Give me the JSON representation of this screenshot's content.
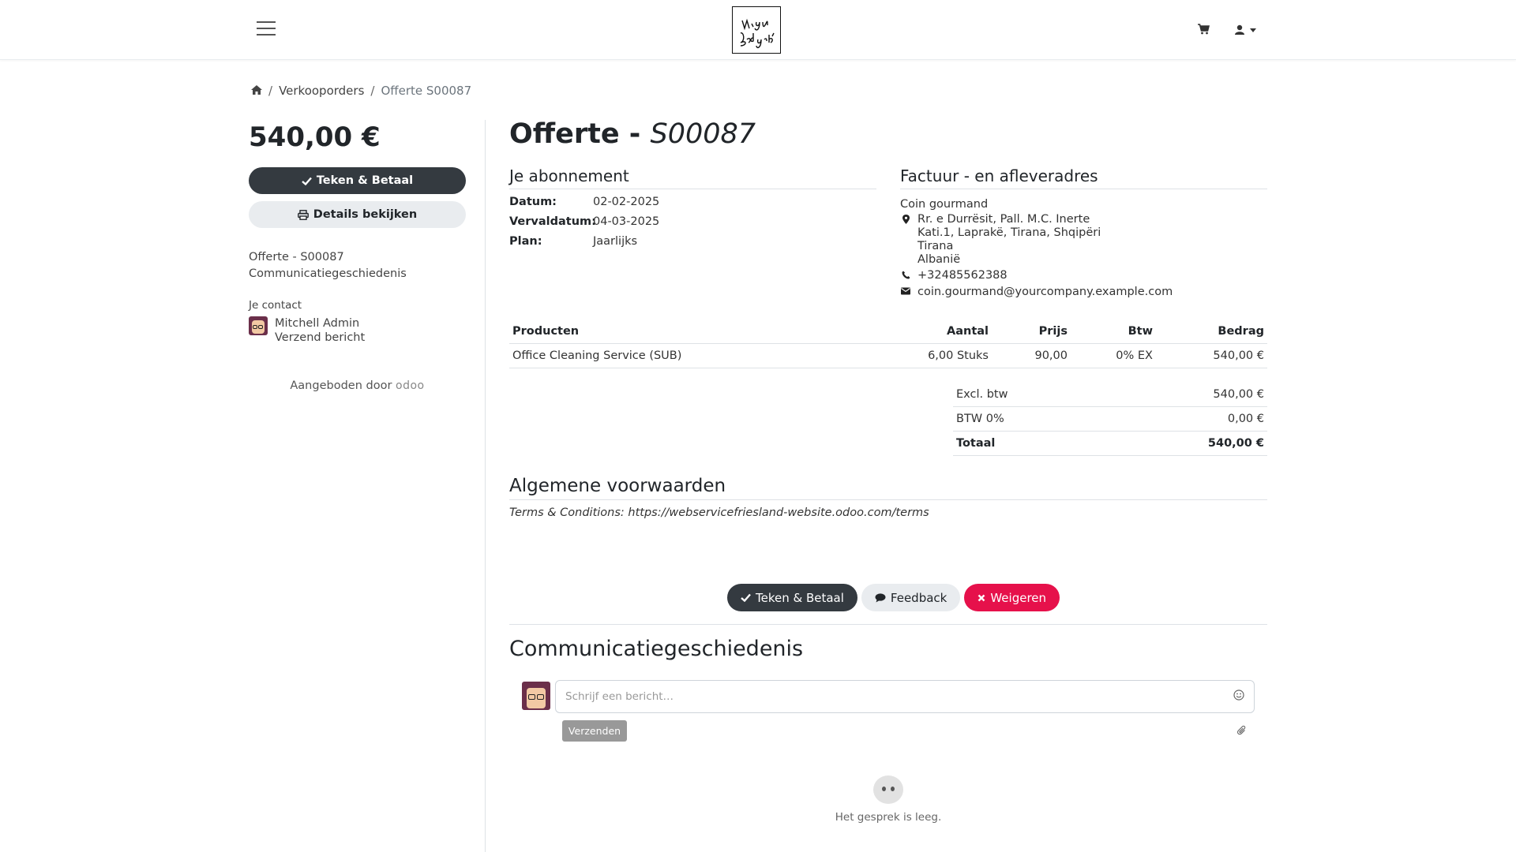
{
  "header": {
    "logo_text": "Mijn Bedrijf",
    "icons": [
      "menu-icon",
      "cart-icon",
      "user-icon"
    ]
  },
  "breadcrumb": {
    "items": [
      "Verkooporders",
      "Offerte S00087"
    ]
  },
  "sidebar": {
    "amount": "540,00 €",
    "sign_pay_label": "Teken & Betaal",
    "details_label": "Details bekijken",
    "links": [
      "Offerte - S00087",
      "Communicatiegeschiedenis"
    ],
    "contact_label": "Je contact",
    "contact_name": "Mitchell Admin",
    "contact_action": "Verzend bericht",
    "powered_by": "Aangeboden door",
    "powered_brand": "odoo"
  },
  "main": {
    "title_prefix": "Offerte - ",
    "title_ref": "S00087",
    "subscription": {
      "heading": "Je abonnement",
      "fields": [
        {
          "label": "Datum:",
          "value": "02-02-2025"
        },
        {
          "label": "Vervaldatum:",
          "value": "04-03-2025"
        },
        {
          "label": "Plan:",
          "value": "Jaarlijks"
        }
      ]
    },
    "address": {
      "heading": "Factuur - en afleveradres",
      "name": "Coin gourmand",
      "lines": [
        "Rr. e Durrësit, Pall. M.C. Inerte",
        "Kati.1, Laprakë, Tirana, Shqipëri",
        "Tirana",
        "Albanië"
      ],
      "phone": "+32485562388",
      "email": "coin.gourmand@yourcompany.example.com"
    },
    "table": {
      "headers": {
        "product": "Producten",
        "qty": "Aantal",
        "price": "Prijs",
        "tax": "Btw",
        "amount": "Bedrag"
      },
      "rows": [
        {
          "product": "Office Cleaning Service (SUB)",
          "qty": "6,00 Stuks",
          "price": "90,00",
          "tax": "0% EX",
          "amount": "540,00 €"
        }
      ]
    },
    "totals": [
      {
        "label": "Excl. btw",
        "value": "540,00 €"
      },
      {
        "label": "BTW 0%",
        "value": "0,00 €"
      },
      {
        "label": "Totaal",
        "value": "540,00 €"
      }
    ],
    "terms": {
      "heading": "Algemene voorwaarden",
      "text": "Terms & Conditions: https://webservicefriesland-website.odoo.com/terms"
    },
    "actions": {
      "sign_pay": "Teken & Betaal",
      "feedback": "Feedback",
      "decline": "Weigeren"
    },
    "chatter": {
      "heading": "Communicatiegeschiedenis",
      "placeholder": "Schrijf een bericht…",
      "send_label": "Verzenden",
      "empty_text": "Het gesprek is leeg."
    }
  },
  "colors": {
    "dark_button": "#343a40",
    "decline_button": "#e6114b",
    "light_button": "#e9ecef"
  }
}
